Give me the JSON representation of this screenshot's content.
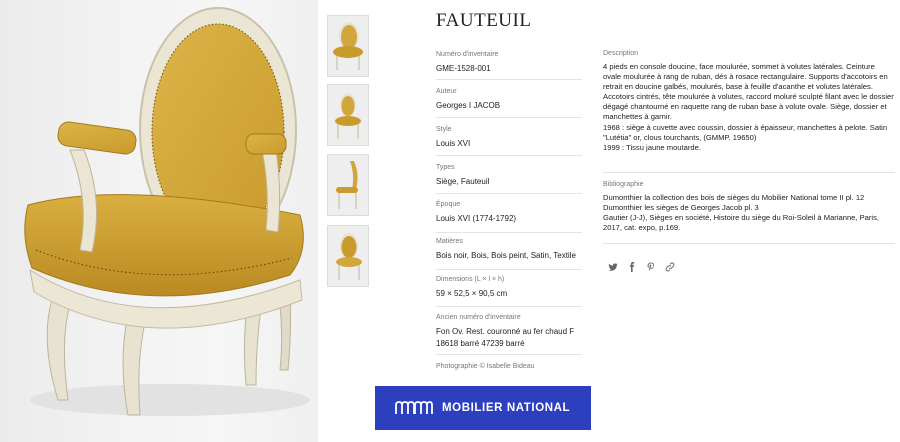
{
  "title": "FAUTEUIL",
  "fields": [
    {
      "label": "Numéro d'inventaire",
      "value": "GME-1528-001"
    },
    {
      "label": "Auteur",
      "value": "Georges I JACOB"
    },
    {
      "label": "Style",
      "value": "Louis XVI"
    },
    {
      "label": "Types",
      "value": "Siège, Fauteuil"
    },
    {
      "label": "Époque",
      "value": "Louis XVI (1774-1792)"
    },
    {
      "label": "Matières",
      "value": "Bois noir, Bois, Bois peint, Satin, Textile"
    },
    {
      "label": "Dimensions (L × l × h)",
      "value": "59 × 52,5 × 90,5 cm"
    },
    {
      "label": "Ancien numéro d'inventaire",
      "value": "Fon Ov. Rest. couronné au fer chaud F 18618 barré 47239 barré"
    }
  ],
  "description": {
    "label": "Description",
    "lines": [
      "4 pieds en console doucine, face moulurée, sommet à volutes latérales. Ceinture ovale moulurée à rang de ruban, dés à rosace rectangulaire. Supports d'accotoirs en retrait en doucine galbés, moulurés, base à feuille d'acanthe et volutes latérales. Accotoirs cintrés, tête moulurée à volutes, raccord moluré sculpté filant avec le dossier dégagé chantourné en raquette rang de ruban base à volute ovale. Siège, dossier et manchettes à garnir.",
      "1968 : siège à cuvette avec coussin, dossier à épaisseur, manchettes à pelote. Satin \"Lutétia\" or, clous tourchants, (GMMP. 19650)",
      "1999 : Tissu jaune moutarde."
    ]
  },
  "bibliography": {
    "label": "Bibliographie",
    "lines": [
      "Dumonthier la collection des bois de sièges du Mobilier National tome II pl. 12",
      "Dumonthier les sièges de Georges Jacob pl. 3",
      "Gautier (J-J), Sièges en société, Histoire du siège du Roi-Soleil à Marianne, Paris, 2017, cat. expo, p.169."
    ]
  },
  "share_icons": [
    "twitter-icon",
    "facebook-icon",
    "pinterest-icon",
    "link-icon"
  ],
  "photo_credit": "Photographie © Isabelle Bideau",
  "banner": {
    "text": "MOBILIER NATIONAL",
    "color": "#2c3fbf"
  },
  "colors": {
    "upholstery": "#d4a93a",
    "frame": "#ece7d8",
    "background": "#f2f2f2"
  }
}
